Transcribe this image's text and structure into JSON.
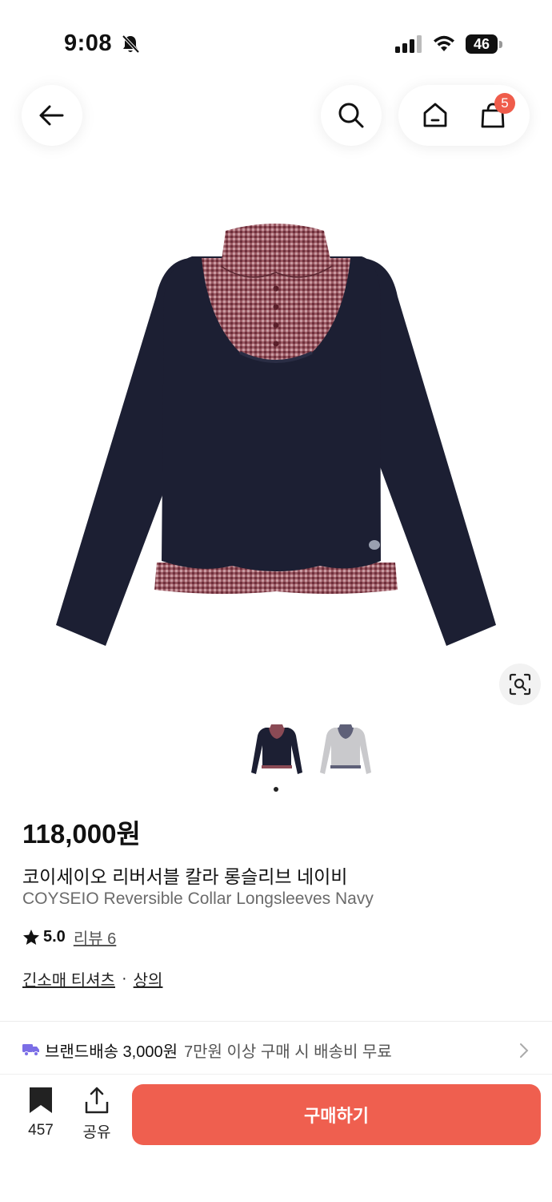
{
  "status_bar": {
    "time": "9:08",
    "battery": "46"
  },
  "header": {
    "cart_count": "5"
  },
  "product": {
    "price": "118,000원",
    "name_ko": "코이세이오 리버서블 칼라 롱슬리브 네이비",
    "name_en": "COYSEIO Reversible Collar Longsleeves Navy",
    "rating": "5.0",
    "review_label": "리뷰 6",
    "category_primary": "긴소매 티셔츠",
    "category_separator": "·",
    "category_secondary": "상의"
  },
  "gallery": {
    "current_index": 1,
    "thumbnail_count": 2
  },
  "shipping": {
    "brand_label": "브랜드배송 3,000원",
    "note": "7만원 이상 구매 시 배송비 무료"
  },
  "bottom_bar": {
    "save_count": "457",
    "share_label": "공유",
    "buy_label": "구매하기"
  },
  "colors": {
    "accent": "#ef5f4f",
    "badge": "#ef5c4b",
    "shipping_truck": "#7b6ee6",
    "garment_navy": "#1c1f33",
    "garment_check": "#8a4a55"
  }
}
